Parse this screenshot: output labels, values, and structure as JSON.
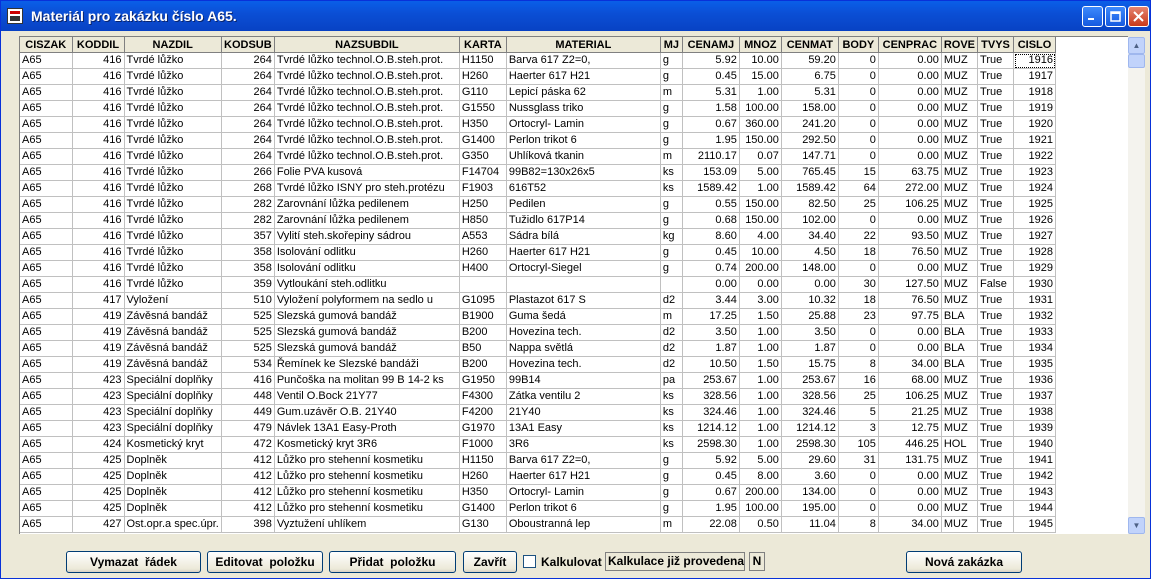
{
  "window": {
    "title": "Materiál pro zakázku číslo A65."
  },
  "grid": {
    "columns": [
      "CISZAK",
      "KODDIL",
      "NAZDIL",
      "KODSUB",
      "NAZSUBDIL",
      "KARTA",
      "MATERIAL",
      "MJ",
      "CENAMJ",
      "MNOZ",
      "CENMAT",
      "BODY",
      "CENPRAC",
      "ROVE",
      "TVYS",
      "CISLO"
    ],
    "rows": [
      [
        "A65",
        "416",
        "Tvrdé lůžko",
        "264",
        "Tvrdé lůžko technol.O.B.steh.prot.",
        "H1150",
        "Barva 617 Z2=0,",
        "g",
        "5.92",
        "10.00",
        "59.20",
        "0",
        "0.00",
        "MUZ",
        "True",
        "1916"
      ],
      [
        "A65",
        "416",
        "Tvrdé lůžko",
        "264",
        "Tvrdé lůžko technol.O.B.steh.prot.",
        "H260",
        "Haerter 617 H21",
        "g",
        "0.45",
        "15.00",
        "6.75",
        "0",
        "0.00",
        "MUZ",
        "True",
        "1917"
      ],
      [
        "A65",
        "416",
        "Tvrdé lůžko",
        "264",
        "Tvrdé lůžko technol.O.B.steh.prot.",
        "G110",
        "Lepicí páska 62",
        "m",
        "5.31",
        "1.00",
        "5.31",
        "0",
        "0.00",
        "MUZ",
        "True",
        "1918"
      ],
      [
        "A65",
        "416",
        "Tvrdé lůžko",
        "264",
        "Tvrdé lůžko technol.O.B.steh.prot.",
        "G1550",
        "Nussglass triko",
        "g",
        "1.58",
        "100.00",
        "158.00",
        "0",
        "0.00",
        "MUZ",
        "True",
        "1919"
      ],
      [
        "A65",
        "416",
        "Tvrdé lůžko",
        "264",
        "Tvrdé lůžko technol.O.B.steh.prot.",
        "H350",
        "Ortocryl- Lamin",
        "g",
        "0.67",
        "360.00",
        "241.20",
        "0",
        "0.00",
        "MUZ",
        "True",
        "1920"
      ],
      [
        "A65",
        "416",
        "Tvrdé lůžko",
        "264",
        "Tvrdé lůžko technol.O.B.steh.prot.",
        "G1400",
        "Perlon trikot 6",
        "g",
        "1.95",
        "150.00",
        "292.50",
        "0",
        "0.00",
        "MUZ",
        "True",
        "1921"
      ],
      [
        "A65",
        "416",
        "Tvrdé lůžko",
        "264",
        "Tvrdé lůžko technol.O.B.steh.prot.",
        "G350",
        "Uhlíková tkanin",
        "m",
        "2110.17",
        "0.07",
        "147.71",
        "0",
        "0.00",
        "MUZ",
        "True",
        "1922"
      ],
      [
        "A65",
        "416",
        "Tvrdé lůžko",
        "266",
        "Folie PVA kusová",
        "F14704",
        "99B82=130x26x5",
        "ks",
        "153.09",
        "5.00",
        "765.45",
        "15",
        "63.75",
        "MUZ",
        "True",
        "1923"
      ],
      [
        "A65",
        "416",
        "Tvrdé lůžko",
        "268",
        "Tvrdé lůžko ISNY pro steh.protézu",
        "F1903",
        "616T52",
        "ks",
        "1589.42",
        "1.00",
        "1589.42",
        "64",
        "272.00",
        "MUZ",
        "True",
        "1924"
      ],
      [
        "A65",
        "416",
        "Tvrdé lůžko",
        "282",
        "Zarovnání lůžka pedilenem",
        "H250",
        "Pedilen",
        "g",
        "0.55",
        "150.00",
        "82.50",
        "25",
        "106.25",
        "MUZ",
        "True",
        "1925"
      ],
      [
        "A65",
        "416",
        "Tvrdé lůžko",
        "282",
        "Zarovnání lůžka pedilenem",
        "H850",
        "Tužidlo 617P14",
        "g",
        "0.68",
        "150.00",
        "102.00",
        "0",
        "0.00",
        "MUZ",
        "True",
        "1926"
      ],
      [
        "A65",
        "416",
        "Tvrdé lůžko",
        "357",
        "Vylití steh.skořepiny sádrou",
        "A553",
        "Sádra bílá",
        "kg",
        "8.60",
        "4.00",
        "34.40",
        "22",
        "93.50",
        "MUZ",
        "True",
        "1927"
      ],
      [
        "A65",
        "416",
        "Tvrdé lůžko",
        "358",
        "Isolování odlitku",
        "H260",
        "Haerter 617 H21",
        "g",
        "0.45",
        "10.00",
        "4.50",
        "18",
        "76.50",
        "MUZ",
        "True",
        "1928"
      ],
      [
        "A65",
        "416",
        "Tvrdé lůžko",
        "358",
        "Isolování odlitku",
        "H400",
        "Ortocryl-Siegel",
        "g",
        "0.74",
        "200.00",
        "148.00",
        "0",
        "0.00",
        "MUZ",
        "True",
        "1929"
      ],
      [
        "A65",
        "416",
        "Tvrdé lůžko",
        "359",
        "Vytloukání steh.odlitku",
        "",
        "",
        "",
        "0.00",
        "0.00",
        "0.00",
        "30",
        "127.50",
        "MUZ",
        "False",
        "1930"
      ],
      [
        "A65",
        "417",
        "Vyložení",
        "510",
        "Vyložení polyformem na sedlo u",
        "G1095",
        "Plastazot 617 S",
        "d2",
        "3.44",
        "3.00",
        "10.32",
        "18",
        "76.50",
        "MUZ",
        "True",
        "1931"
      ],
      [
        "A65",
        "419",
        "Závěsná bandáž",
        "525",
        "Slezská gumová bandáž",
        "B1900",
        "Guma šedá",
        "m",
        "17.25",
        "1.50",
        "25.88",
        "23",
        "97.75",
        "BLA",
        "True",
        "1932"
      ],
      [
        "A65",
        "419",
        "Závěsná bandáž",
        "525",
        "Slezská gumová bandáž",
        "B200",
        "Hovezina tech.",
        "d2",
        "3.50",
        "1.00",
        "3.50",
        "0",
        "0.00",
        "BLA",
        "True",
        "1933"
      ],
      [
        "A65",
        "419",
        "Závěsná bandáž",
        "525",
        "Slezská gumová bandáž",
        "B50",
        "Nappa světlá",
        "d2",
        "1.87",
        "1.00",
        "1.87",
        "0",
        "0.00",
        "BLA",
        "True",
        "1934"
      ],
      [
        "A65",
        "419",
        "Závěsná bandáž",
        "534",
        "Řemínek ke Slezské bandáži",
        "B200",
        "Hovezina tech.",
        "d2",
        "10.50",
        "1.50",
        "15.75",
        "8",
        "34.00",
        "BLA",
        "True",
        "1935"
      ],
      [
        "A65",
        "423",
        "Speciální doplňky",
        "416",
        "Punčoška na molitan 99 B 14-2 ks",
        "G1950",
        "99B14",
        "pa",
        "253.67",
        "1.00",
        "253.67",
        "16",
        "68.00",
        "MUZ",
        "True",
        "1936"
      ],
      [
        "A65",
        "423",
        "Speciální doplňky",
        "448",
        "Ventil O.Bock 21Y77",
        "F4300",
        "Zátka ventilu 2",
        "ks",
        "328.56",
        "1.00",
        "328.56",
        "25",
        "106.25",
        "MUZ",
        "True",
        "1937"
      ],
      [
        "A65",
        "423",
        "Speciální doplňky",
        "449",
        "Gum.uzávěr O.B. 21Y40",
        "F4200",
        "21Y40",
        "ks",
        "324.46",
        "1.00",
        "324.46",
        "5",
        "21.25",
        "MUZ",
        "True",
        "1938"
      ],
      [
        "A65",
        "423",
        "Speciální doplňky",
        "479",
        "Návlek 13A1 Easy-Proth",
        "G1970",
        "13A1 Easy",
        "ks",
        "1214.12",
        "1.00",
        "1214.12",
        "3",
        "12.75",
        "MUZ",
        "True",
        "1939"
      ],
      [
        "A65",
        "424",
        "Kosmetický kryt",
        "472",
        "Kosmetický kryt 3R6",
        "F1000",
        "3R6",
        "ks",
        "2598.30",
        "1.00",
        "2598.30",
        "105",
        "446.25",
        "HOL",
        "True",
        "1940"
      ],
      [
        "A65",
        "425",
        "Doplněk",
        "412",
        "Lůžko pro stehenní kosmetiku",
        "H1150",
        "Barva 617 Z2=0,",
        "g",
        "5.92",
        "5.00",
        "29.60",
        "31",
        "131.75",
        "MUZ",
        "True",
        "1941"
      ],
      [
        "A65",
        "425",
        "Doplněk",
        "412",
        "Lůžko pro stehenní kosmetiku",
        "H260",
        "Haerter 617 H21",
        "g",
        "0.45",
        "8.00",
        "3.60",
        "0",
        "0.00",
        "MUZ",
        "True",
        "1942"
      ],
      [
        "A65",
        "425",
        "Doplněk",
        "412",
        "Lůžko pro stehenní kosmetiku",
        "H350",
        "Ortocryl- Lamin",
        "g",
        "0.67",
        "200.00",
        "134.00",
        "0",
        "0.00",
        "MUZ",
        "True",
        "1943"
      ],
      [
        "A65",
        "425",
        "Doplněk",
        "412",
        "Lůžko pro stehenní kosmetiku",
        "G1400",
        "Perlon trikot 6",
        "g",
        "1.95",
        "100.00",
        "195.00",
        "0",
        "0.00",
        "MUZ",
        "True",
        "1944"
      ],
      [
        "A65",
        "427",
        "Ost.opr.a spec.úpr.",
        "398",
        "Vyztužení uhlíkem",
        "G130",
        "Oboustranná lep",
        "m",
        "22.08",
        "0.50",
        "11.04",
        "8",
        "34.00",
        "MUZ",
        "True",
        "1945"
      ]
    ]
  },
  "footer": {
    "delete_row": "Vymazat  řádek",
    "edit_item": "Editovat  položku",
    "add_item": "Přidat  položku",
    "close": "Zavřít",
    "calc_label": "Kalkulovat",
    "calc_status": "Kalkulace již provedena",
    "calc_flag": "N",
    "new_order": "Nová zakázka"
  },
  "icons": {
    "app": "app-icon",
    "minimize": "minimize-icon",
    "maximize": "maximize-icon",
    "close": "close-icon"
  },
  "colors": {
    "titlebar": "#0b4fd6",
    "window_bg": "#ece9d8",
    "close_button": "#c9391a"
  }
}
